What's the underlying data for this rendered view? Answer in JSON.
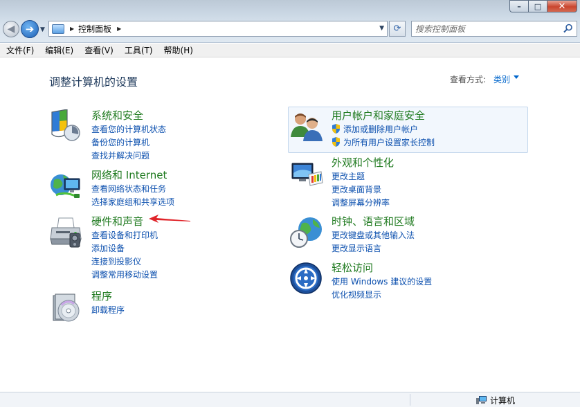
{
  "window": {
    "minimize_glyph": "–",
    "maximize_glyph": "□",
    "close_glyph": "✕"
  },
  "navigation": {
    "back_glyph": "◀",
    "forward_glyph": "➔",
    "address_icon": "control-panel-icon",
    "breadcrumb": "控制面板",
    "refresh_glyph": "⟳"
  },
  "search": {
    "placeholder": "搜索控制面板",
    "icon": "search-icon"
  },
  "menubar": [
    "文件(F)",
    "编辑(E)",
    "查看(V)",
    "工具(T)",
    "帮助(H)"
  ],
  "main": {
    "title": "调整计算机的设置",
    "view_by_label": "查看方式:",
    "view_by_value": "类别"
  },
  "categories": [
    {
      "id": "system-security",
      "icon": "system-security-icon",
      "title": "系统和安全",
      "links": [
        "查看您的计算机状态",
        "备份您的计算机",
        "查找并解决问题"
      ]
    },
    {
      "id": "network",
      "icon": "network-icon",
      "title": "网络和 Internet",
      "links": [
        "查看网络状态和任务",
        "选择家庭组和共享选项"
      ]
    },
    {
      "id": "hardware-sound",
      "icon": "printer-icon",
      "title": "硬件和声音",
      "links": [
        "查看设备和打印机",
        "添加设备",
        "连接到投影仪",
        "调整常用移动设置"
      ]
    },
    {
      "id": "programs",
      "icon": "programs-icon",
      "title": "程序",
      "links": [
        "卸载程序"
      ]
    },
    {
      "id": "user-accounts",
      "icon": "users-icon",
      "title": "用户帐户和家庭安全",
      "links": [
        "添加或删除用户帐户",
        "为所有用户设置家长控制"
      ]
    },
    {
      "id": "appearance",
      "icon": "appearance-icon",
      "title": "外观和个性化",
      "links": [
        "更改主题",
        "更改桌面背景",
        "调整屏幕分辨率"
      ]
    },
    {
      "id": "clock-region",
      "icon": "clock-globe-icon",
      "title": "时钟、语言和区域",
      "links": [
        "更改键盘或其他输入法",
        "更改显示语言"
      ]
    },
    {
      "id": "ease-of-access",
      "icon": "ease-of-access-icon",
      "title": "轻松访问",
      "links": [
        "使用 Windows 建议的设置",
        "优化视频显示"
      ]
    }
  ],
  "statusbar": {
    "icon": "computer-icon",
    "text": "计算机"
  },
  "colors": {
    "category_title": "#1f7a1f",
    "link": "#0b4fae",
    "annotation_arrow": "#e0242a"
  }
}
